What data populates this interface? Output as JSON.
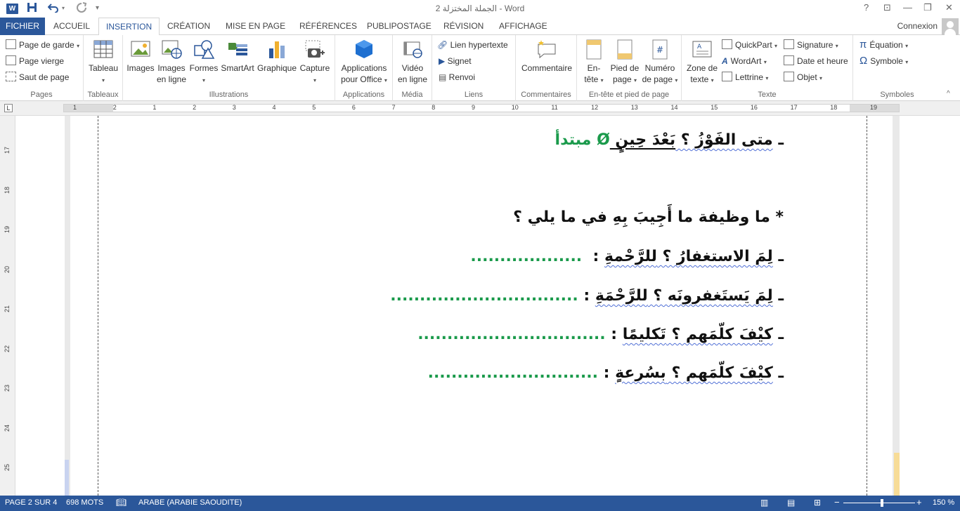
{
  "titlebar": {
    "doc_title": "الجملة المختزلة 2 - Word",
    "app_icon": "W",
    "help": "?",
    "display_options": "⊡",
    "minimize": "—",
    "restore": "❐",
    "close": "✕"
  },
  "tabs": {
    "file": "FICHIER",
    "items": [
      "ACCUEIL",
      "INSERTION",
      "CRÉATION",
      "MISE EN PAGE",
      "RÉFÉRENCES",
      "PUBLIPOSTAGE",
      "RÉVISION",
      "AFFICHAGE"
    ],
    "active": "INSERTION",
    "connexion": "Connexion"
  },
  "ribbon": {
    "pages": {
      "label": "Pages",
      "cover": "Page de garde",
      "blank": "Page vierge",
      "break": "Saut de page"
    },
    "tables": {
      "label": "Tableaux",
      "table": "Tableau"
    },
    "illustrations": {
      "label": "Illustrations",
      "images": "Images",
      "online_1": "Images",
      "online_2": "en ligne",
      "shapes": "Formes",
      "smartart": "SmartArt",
      "chart": "Graphique",
      "capture": "Capture"
    },
    "apps": {
      "label": "Applications",
      "line1": "Applications",
      "line2": "pour Office"
    },
    "media": {
      "label": "Média",
      "line1": "Vidéo",
      "line2": "en ligne"
    },
    "links": {
      "label": "Liens",
      "hyperlink": "Lien hypertexte",
      "bookmark": "Signet",
      "crossref": "Renvoi"
    },
    "comments": {
      "label": "Commentaires",
      "comment": "Commentaire"
    },
    "header_footer": {
      "label": "En-tête et pied de page",
      "header_1": "En-",
      "header_2": "tête",
      "footer_1": "Pied de",
      "footer_2": "page",
      "pagenum_1": "Numéro",
      "pagenum_2": "de page"
    },
    "text": {
      "label": "Texte",
      "textbox_1": "Zone de",
      "textbox_2": "texte",
      "quickpart": "QuickPart",
      "wordart": "WordArt",
      "dropcap": "Lettrine",
      "signature": "Signature",
      "datetime": "Date et heure",
      "object": "Objet"
    },
    "symbols": {
      "label": "Symboles",
      "equation": "Équation",
      "symbol": "Symbole"
    }
  },
  "ruler": {
    "corner": "L",
    "h_ticks": [
      "1",
      "2",
      "1",
      "2",
      "3",
      "4",
      "5",
      "6",
      "7",
      "8",
      "9",
      "10",
      "11",
      "12",
      "13",
      "14",
      "15",
      "16",
      "17",
      "18",
      "19"
    ],
    "v_ticks": [
      "17",
      "18",
      "19",
      "20",
      "21",
      "22",
      "23",
      "24",
      "25"
    ]
  },
  "document": {
    "line1": {
      "dash": "ـ ",
      "question": "متى الفَوْزُ ؟ ",
      "answer": "بَعْدَ حِينٍ ",
      "symbol": "Ø ",
      "role": "مبتدأ"
    },
    "line2": {
      "text": "* ما وظيفة ما أَجِيبَ بِهِ في ما يلي ؟"
    },
    "line3": {
      "dash": "ـ ",
      "question": "لِمَ الاستغفارُ ؟ ",
      "answer": "للرَّحْمةِ",
      "colon": " : ",
      "dots": "..................."
    },
    "line4": {
      "dash": "ـ ",
      "question": "لِمَ يَستَغفرونَه ؟ ",
      "answer": "للرَّحْمَةِ",
      "colon": " : ",
      "dots": "................................"
    },
    "line5": {
      "dash": "ـ ",
      "question": "كيْفَ كلّمَهم ؟ ",
      "answer": "تَكليمًا",
      "colon": " : ",
      "dots": "................................"
    },
    "line6": {
      "dash": "ـ ",
      "question": "كيْفَ كلّمَهم ؟ ",
      "answer": "بسُرعةٍ",
      "colon": " : ",
      "dots": "............................."
    }
  },
  "status": {
    "page": "PAGE 2 SUR 4",
    "words": "698 MOTS",
    "language": "ARABE (ARABIE SAOUDITE)",
    "zoom": "150 %",
    "zoom_minus": "−",
    "zoom_plus": "+"
  },
  "colors": {
    "accent": "#2b579a",
    "answer_green": "#1a9a4b",
    "spell_wave": "#4f6fd6"
  }
}
